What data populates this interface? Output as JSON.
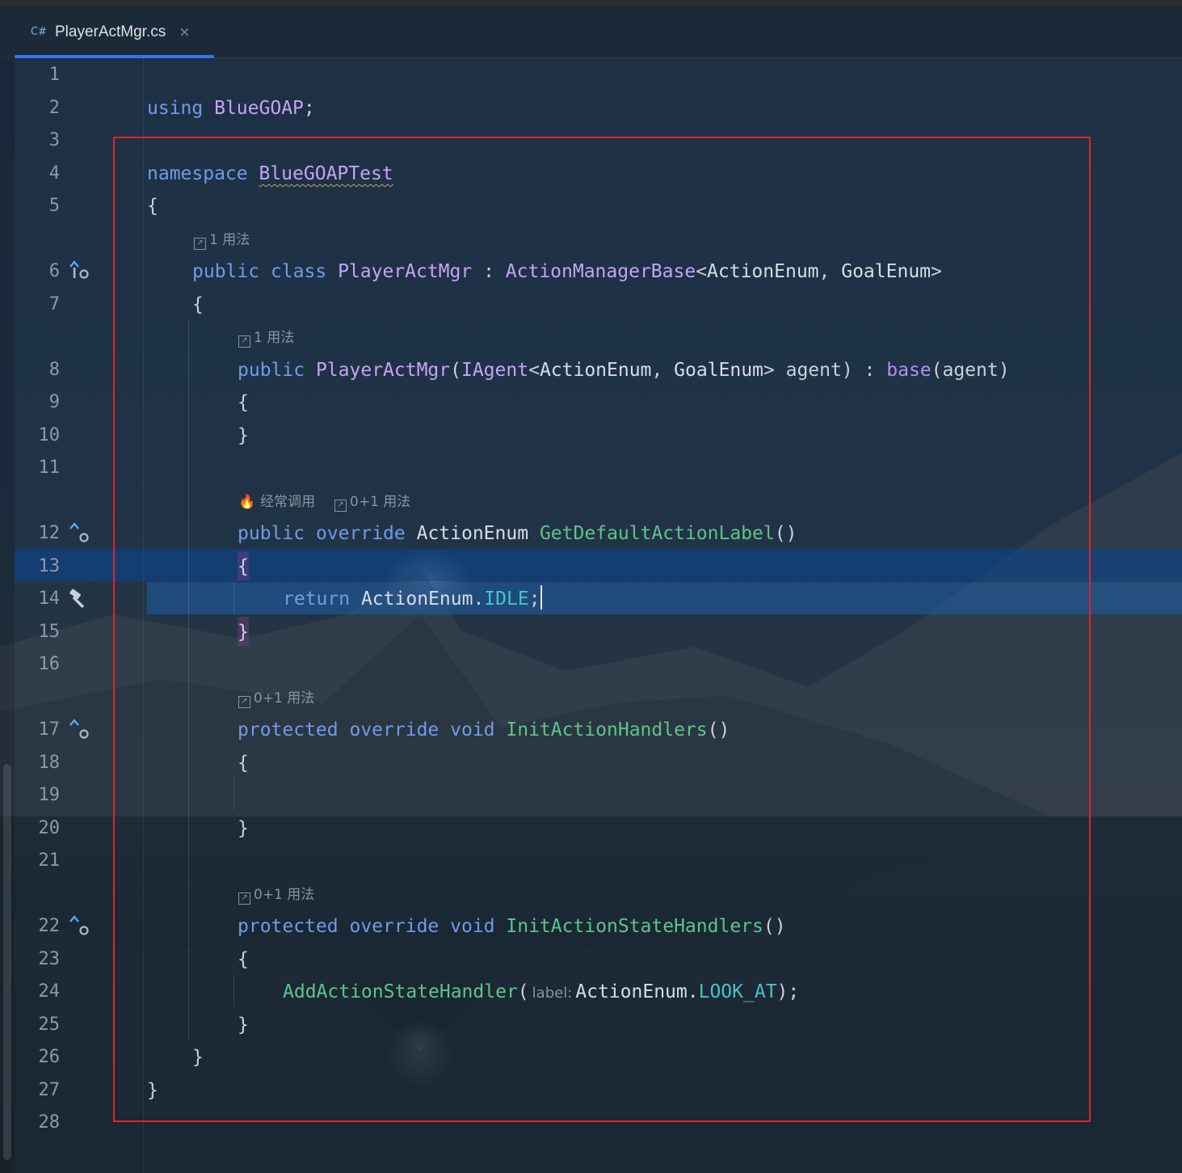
{
  "tab": {
    "lang": "C#",
    "filename": "PlayerActMgr.cs",
    "close": "×"
  },
  "line_numbers": [
    "1",
    "2",
    "3",
    "4",
    "5",
    "6",
    "7",
    "8",
    "9",
    "10",
    "11",
    "12",
    "13",
    "14",
    "15",
    "16",
    "17",
    "18",
    "19",
    "20",
    "21",
    "22",
    "23",
    "24",
    "25",
    "26",
    "27",
    "28"
  ],
  "hints": {
    "class_usage": "1 用法",
    "ctor_usage": "1 用法",
    "frequent": "经常调用",
    "get_default_usage": "0+1 用法",
    "init_action_usage": "0+1 用法",
    "init_state_usage": "0+1 用法"
  },
  "code": {
    "l2_kw": "using",
    "l2_ns": "BlueGOAP",
    "l2_end": ";",
    "l4_kw": "namespace",
    "l4_ns": "BlueGOAPTest",
    "l5": "{",
    "l6_kw1": "public",
    "l6_kw2": "class",
    "l6_name": "PlayerActMgr",
    "l6_colon": " : ",
    "l6_base": "ActionManagerBase",
    "l6_lt": "<",
    "l6_t1": "ActionEnum",
    "l6_comma": ", ",
    "l6_t2": "GoalEnum",
    "l6_gt": ">",
    "l7": "{",
    "l8_kw": "public",
    "l8_name": "PlayerActMgr",
    "l8_open": "(",
    "l8_iface": "IAgent",
    "l8_lt": "<",
    "l8_t1": "ActionEnum",
    "l8_comma": ", ",
    "l8_t2": "GoalEnum",
    "l8_gt": ">",
    "l8_param": " agent) : ",
    "l8_base": "base",
    "l8_rest": "(agent)",
    "l9": "{",
    "l10": "}",
    "l12_kw1": "public",
    "l12_kw2": "override",
    "l12_type": "ActionEnum",
    "l12_fn": "GetDefaultActionLabel",
    "l12_parens": "()",
    "l13": "{",
    "l14_kw": "return",
    "l14_cls": "ActionEnum",
    "l14_dot": ".",
    "l14_val": "IDLE",
    "l14_end": ";",
    "l15": "}",
    "l17_kw1": "protected",
    "l17_kw2": "override",
    "l17_kw3": "void",
    "l17_fn": "InitActionHandlers",
    "l17_parens": "()",
    "l18": "{",
    "l20": "}",
    "l22_kw1": "protected",
    "l22_kw2": "override",
    "l22_kw3": "void",
    "l22_fn": "InitActionStateHandlers",
    "l22_parens": "()",
    "l23": "{",
    "l24_fn": "AddActionStateHandler",
    "l24_open": "(",
    "l24_label": "label:",
    "l24_cls": "ActionEnum",
    "l24_dot": ".",
    "l24_val": "LOOK_AT",
    "l24_end": ");",
    "l25": "}",
    "l26": "}",
    "l27": "}"
  },
  "gutter_icons": {
    "l6": "implemented-override-icon",
    "l12": "override-icon",
    "l14": "hammer-icon",
    "l17": "override-icon",
    "l22": "override-icon"
  },
  "colors": {
    "accent": "#3574f0",
    "selection_box": "#e0242c",
    "keyword": "#6f9be8",
    "function": "#5ec48a",
    "enum_value": "#49c2c8"
  }
}
